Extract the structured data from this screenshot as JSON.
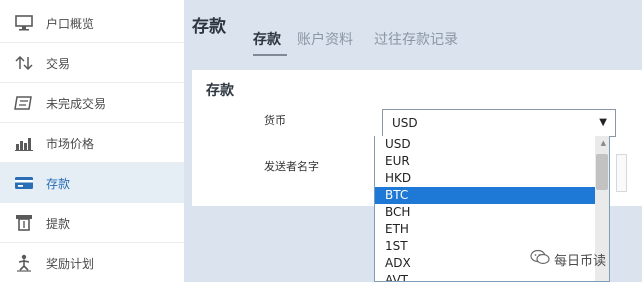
{
  "sidebar": {
    "items": [
      {
        "label": "户口概览",
        "icon": "monitor-icon"
      },
      {
        "label": "交易",
        "icon": "transfer-icon"
      },
      {
        "label": "未完成交易",
        "icon": "pending-orders-icon"
      },
      {
        "label": "市场价格",
        "icon": "market-chart-icon"
      },
      {
        "label": "存款",
        "icon": "deposit-card-icon",
        "active": true
      },
      {
        "label": "提款",
        "icon": "withdraw-icon"
      },
      {
        "label": "奖励计划",
        "icon": "rewards-icon"
      }
    ]
  },
  "header": {
    "title": "存款",
    "tabs": [
      {
        "label": "存款",
        "active": true
      },
      {
        "label": "账户资料"
      },
      {
        "label": "过往存款记录"
      }
    ]
  },
  "form": {
    "title": "存款",
    "currency_label": "货币",
    "currency_value": "USD",
    "sender_label": "发送者名字"
  },
  "dropdown": {
    "options": [
      "USD",
      "EUR",
      "HKD",
      "BTC",
      "BCH",
      "ETH",
      "1ST",
      "ADX",
      "AVT"
    ],
    "highlighted": "BTC"
  },
  "watermark": {
    "text": "每日币读"
  },
  "colors": {
    "accent": "#2a6eb5",
    "highlight": "#1e78d6",
    "main_bg": "#dbe4ee",
    "active_nav_bg": "#e5edf5"
  }
}
